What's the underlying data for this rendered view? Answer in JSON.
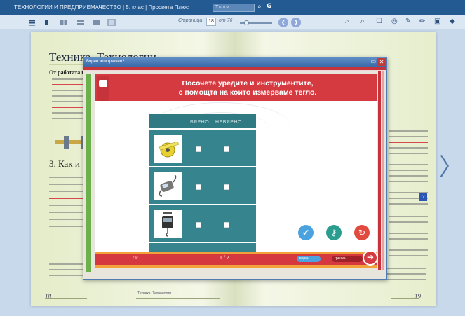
{
  "titlebar": {
    "title": "ТЕХНОЛОГИИ И ПРЕДПРИЕМАЧЕСТВО | 5. клас | Просвета Плюс",
    "search_placeholder": "Търси"
  },
  "toolbar": {
    "page_label": "Страница",
    "current_page": "18",
    "of_label": "от 76"
  },
  "book": {
    "left_heading": "Техника. Технологии",
    "left_sub": "От работата г",
    "section3": "3. Как и",
    "left_page_number": "18",
    "right_page_number": "19",
    "footer_text": "Техника. Технологии"
  },
  "dialog": {
    "title": "Вярно или грешно?",
    "question": "Посочете уредите и инструментите,\nс помощта на които измерваме тегло.",
    "columns": [
      "ВЯРНО",
      "НЕВЯРНО"
    ],
    "rows": [
      {
        "item": "measuring-tape"
      },
      {
        "item": "digital-hook-scale"
      },
      {
        "item": "spring-balance"
      }
    ],
    "counter": "1 / 2",
    "prev_label": "Ок",
    "correct_label": "верен",
    "wrong_label": "грешен"
  },
  "colors": {
    "accent_red": "#d43a40",
    "quiz_teal": "#36848d",
    "green": "#69b148",
    "check_blue": "#4aa3df",
    "key_teal": "#2a9d8f",
    "retry_red": "#e04a3f"
  }
}
